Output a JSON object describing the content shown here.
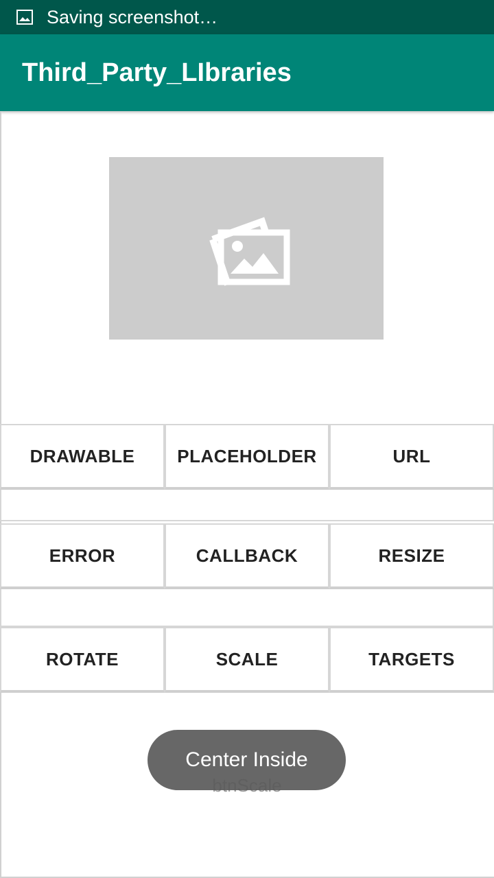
{
  "status_bar": {
    "text": "Saving screenshot…",
    "icon": "image-icon"
  },
  "app_bar": {
    "title": "Third_Party_LIbraries"
  },
  "image_view": {
    "icon": "image-placeholder-icon"
  },
  "buttons": {
    "row1": [
      "DRAWABLE",
      "PLACEHOLDER",
      "URL"
    ],
    "row2": [
      "ERROR",
      "CALLBACK",
      "RESIZE"
    ],
    "row3": [
      "ROTATE",
      "SCALE",
      "TARGETS"
    ]
  },
  "hint": "btnScale",
  "toast": "Center Inside",
  "colors": {
    "status_bar": "#00574b",
    "app_bar": "#008577",
    "image_bg": "#cccccc"
  }
}
